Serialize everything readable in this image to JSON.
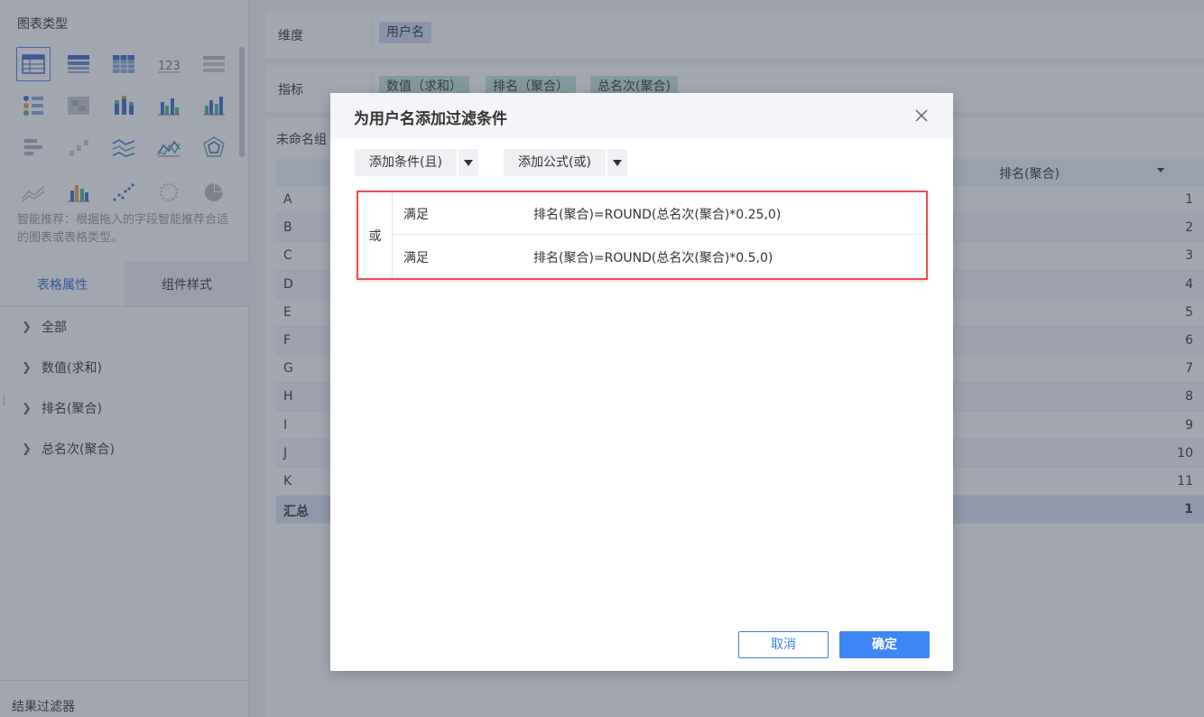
{
  "left_panel": {
    "chart_type_title": "图表类型",
    "hint": "智能推荐：根据拖入的字段智能推荐合适的图表或表格类型。",
    "tabs": [
      {
        "label": "表格属性",
        "active": true
      },
      {
        "label": "组件样式",
        "active": false
      }
    ],
    "tree_items": [
      {
        "label": "全部"
      },
      {
        "label": "数值(求和)"
      },
      {
        "label": "排名(聚合)"
      },
      {
        "label": "总名次(聚合)"
      }
    ],
    "result_filter": "结果过滤器"
  },
  "main": {
    "dimension_label": "维度",
    "dimension_pills": [
      "用户名"
    ],
    "measure_label": "指标",
    "measure_pills": [
      "数值（求和）",
      "排名（聚合）",
      "总名次(聚合)"
    ],
    "group_label": "未命名组",
    "table": {
      "header_right": "排名(聚合)",
      "rows": [
        {
          "name": "A",
          "value": "1"
        },
        {
          "name": "B",
          "value": "2"
        },
        {
          "name": "C",
          "value": "3"
        },
        {
          "name": "D",
          "value": "4"
        },
        {
          "name": "E",
          "value": "5"
        },
        {
          "name": "F",
          "value": "6"
        },
        {
          "name": "G",
          "value": "7"
        },
        {
          "name": "H",
          "value": "8"
        },
        {
          "name": "I",
          "value": "9"
        },
        {
          "name": "J",
          "value": "10"
        },
        {
          "name": "K",
          "value": "11"
        }
      ],
      "total": {
        "name": "汇总",
        "value": "1"
      }
    }
  },
  "dialog": {
    "title": "为用户名添加过滤条件",
    "add_condition_and": "添加条件(且)",
    "add_formula_or": "添加公式(或)",
    "logic_label": "或",
    "conditions": [
      {
        "type": "满足",
        "formula": "排名(聚合)=ROUND(总名次(聚合)*0.25,0)"
      },
      {
        "type": "满足",
        "formula": "排名(聚合)=ROUND(总名次(聚合)*0.5,0)"
      }
    ],
    "cancel": "取消",
    "ok": "确定"
  },
  "colors": {
    "accent": "#3d87f5",
    "highlight_border": "#e45252",
    "dimension_pill": "#cddcf2",
    "measure_pill": "#c3e7df"
  }
}
